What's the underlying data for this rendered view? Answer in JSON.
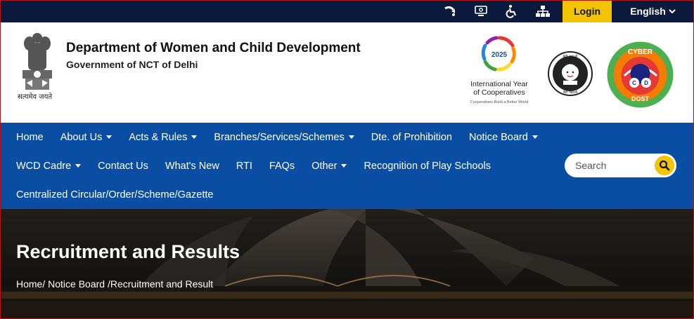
{
  "topbar": {
    "icons": [
      "skip-to-content-icon",
      "screen-reader-icon",
      "accessibility-icon",
      "sitemap-icon"
    ],
    "login_label": "Login",
    "language_label": "English"
  },
  "header": {
    "emblem_motto": "सत्यमेव जयते",
    "title": "Department of Women and Child Development",
    "subtitle": "Government of NCT of Delhi",
    "iyc_year": "2025",
    "iyc_line1": "International Year",
    "iyc_line2": "of Cooperatives",
    "iyc_tagline": "Cooperatives Build a Better World",
    "bbbp_top": "बेटी बचाओ",
    "bbbp_bottom": "बेटी पढ़ाओ",
    "cyber_top": "CYBER",
    "cyber_c": "C",
    "cyber_d": "D",
    "cyber_bottom": "DOST"
  },
  "nav": {
    "row1": [
      {
        "label": "Home",
        "dropdown": false
      },
      {
        "label": "About Us",
        "dropdown": true
      },
      {
        "label": "Acts & Rules",
        "dropdown": true
      },
      {
        "label": "Branches/Services/Schemes",
        "dropdown": true
      },
      {
        "label": "Dte. of Prohibition",
        "dropdown": false
      },
      {
        "label": "Notice Board",
        "dropdown": true
      }
    ],
    "row2": [
      {
        "label": "WCD Cadre",
        "dropdown": true
      },
      {
        "label": "Contact Us",
        "dropdown": false
      },
      {
        "label": "What's New",
        "dropdown": false
      },
      {
        "label": "RTI",
        "dropdown": false
      },
      {
        "label": "FAQs",
        "dropdown": false
      },
      {
        "label": "Other",
        "dropdown": true
      },
      {
        "label": "Recognition of Play Schools",
        "dropdown": false
      }
    ],
    "row3": [
      {
        "label": "Centralized Circular/Order/Scheme/Gazette",
        "dropdown": false
      }
    ],
    "search_placeholder": "Search"
  },
  "hero": {
    "title": "Recruitment and Results",
    "breadcrumb": [
      "Home",
      "Notice Board",
      "Recruitment and Result"
    ]
  },
  "colors": {
    "topbar": "#0b1a3c",
    "nav": "#0a4ea3",
    "accent": "#f5c400",
    "frame": "#b5121b"
  }
}
